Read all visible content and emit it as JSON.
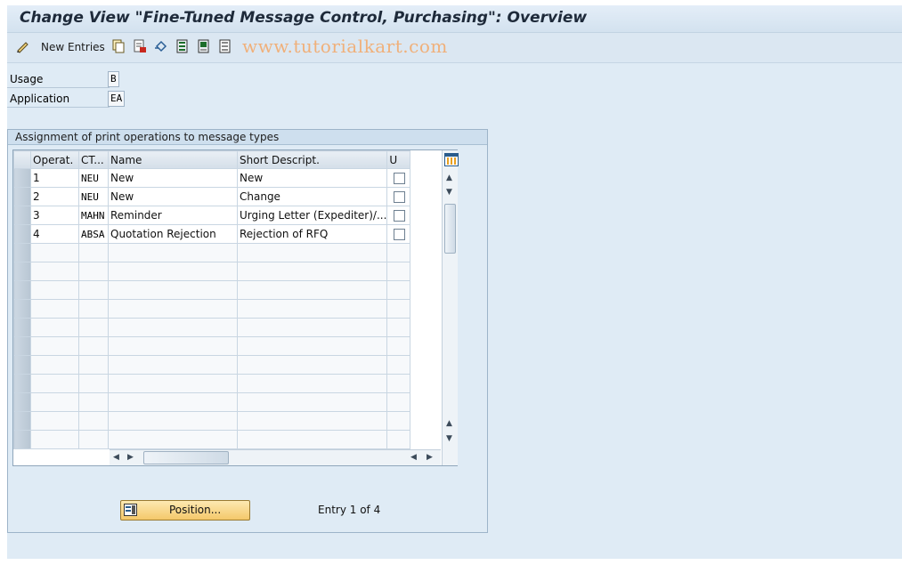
{
  "window": {
    "title": "Change View \"Fine-Tuned Message Control, Purchasing\": Overview"
  },
  "toolbar": {
    "new_entries": "New Entries",
    "watermark": "www.tutorialkart.com",
    "icons": [
      "edit-pencil-icon",
      "copy-icon",
      "delete-icon",
      "undo-icon",
      "select-all-icon",
      "select-block-icon",
      "deselect-all-icon"
    ]
  },
  "fields": {
    "usage_label": "Usage",
    "usage_value": "B",
    "application_label": "Application",
    "application_value": "EA"
  },
  "group": {
    "title": "Assignment of print operations to message types",
    "columns": [
      "Operat.",
      "CT...",
      "Name",
      "Short Descript.",
      "U"
    ],
    "rows": [
      {
        "operat": "1",
        "ct": "NEU",
        "name": "New",
        "short": "New",
        "u": false
      },
      {
        "operat": "2",
        "ct": "NEU",
        "name": "New",
        "short": "Change",
        "u": false
      },
      {
        "operat": "3",
        "ct": "MAHN",
        "name": "Reminder",
        "short": "Urging Letter (Expediter)/...",
        "u": false
      },
      {
        "operat": "4",
        "ct": "ABSA",
        "name": "Quotation Rejection",
        "short": "Rejection of RFQ",
        "u": false
      }
    ]
  },
  "footer": {
    "position_button": "Position...",
    "entry_info": "Entry 1 of 4"
  },
  "colors": {
    "frame": "#dfebf5",
    "button": "#f4c86a",
    "watermark": "#f0b07a"
  }
}
